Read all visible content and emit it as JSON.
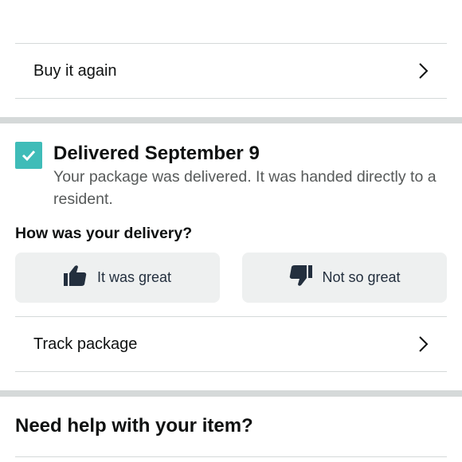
{
  "buy_again": {
    "label": "Buy it again"
  },
  "delivery": {
    "title": "Delivered September 9",
    "description": "Your package was delivered. It was handed directly to a resident.",
    "status_icon": "check-icon",
    "status_color": "#3fbcb8"
  },
  "feedback": {
    "question": "How was your delivery?",
    "great_label": "It was great",
    "great_icon": "thumbs-up-icon",
    "not_great_label": "Not so great",
    "not_great_icon": "thumbs-down-icon"
  },
  "track": {
    "label": "Track package"
  },
  "help": {
    "title": "Need help with your item?"
  }
}
